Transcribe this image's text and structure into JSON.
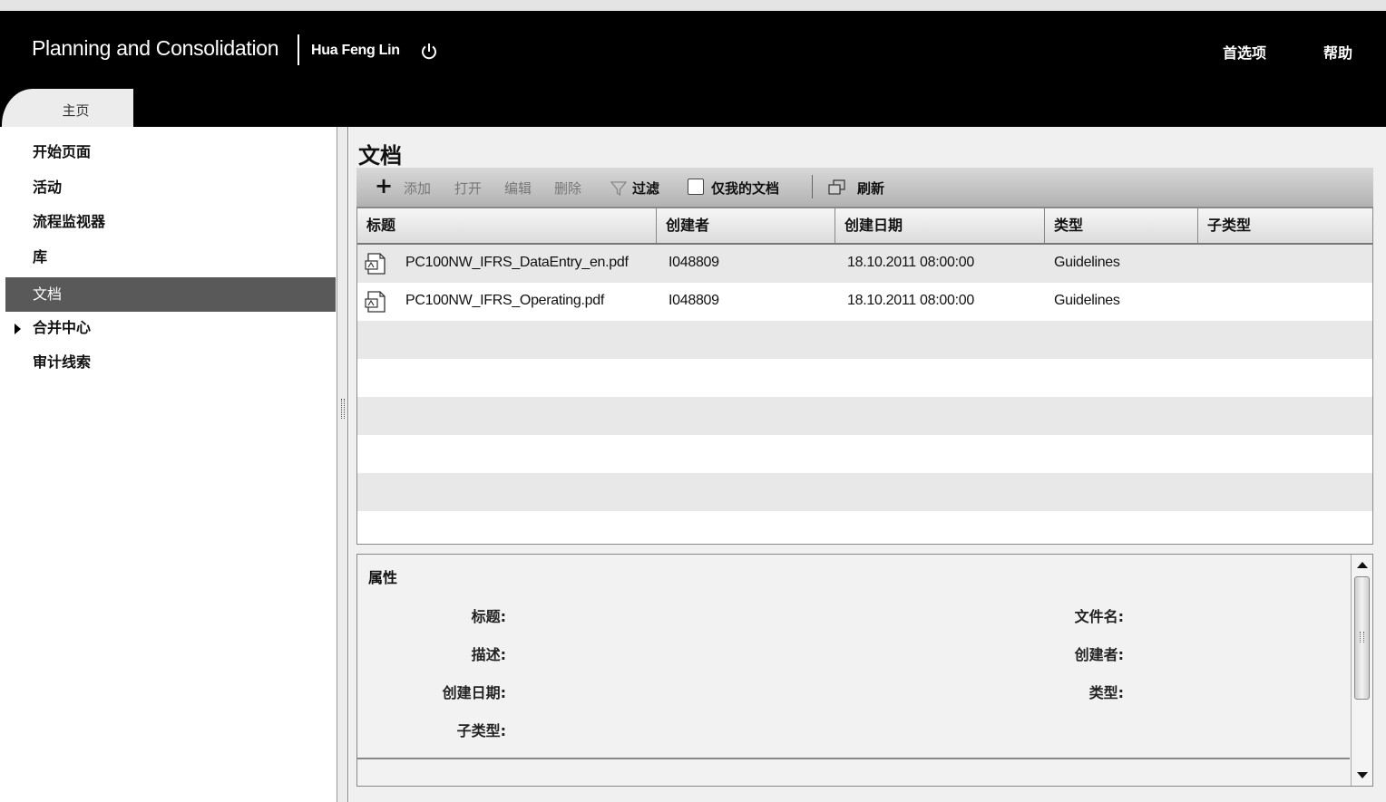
{
  "header": {
    "app_title": "Planning and Consolidation",
    "user_name": "Hua Feng Lin",
    "preferences": "首选项",
    "help": "帮助"
  },
  "tabs": {
    "home": "主页"
  },
  "sidebar": {
    "items": [
      {
        "label": "开始页面",
        "active": false
      },
      {
        "label": "活动",
        "active": false
      },
      {
        "label": "流程监视器",
        "active": false
      },
      {
        "label": "库",
        "active": false
      },
      {
        "label": "文档",
        "active": true
      },
      {
        "label": "合并中心",
        "active": false,
        "expandable": true
      },
      {
        "label": "审计线索",
        "active": false
      }
    ]
  },
  "main": {
    "title": "文档",
    "toolbar": {
      "add": "添加",
      "open": "打开",
      "edit": "编辑",
      "delete": "删除",
      "filter": "过滤",
      "my_docs_only": "仅我的文档",
      "refresh": "刷新"
    },
    "grid": {
      "columns": [
        "标题",
        "创建者",
        "创建日期",
        "类型",
        "子类型"
      ],
      "rows": [
        {
          "title": "PC100NW_IFRS_DataEntry_en.pdf",
          "creator": "I048809",
          "date": "18.10.2011 08:00:00",
          "type": "Guidelines",
          "subtype": ""
        },
        {
          "title": "PC100NW_IFRS_Operating.pdf",
          "creator": "I048809",
          "date": "18.10.2011 08:00:00",
          "type": "Guidelines",
          "subtype": ""
        }
      ]
    },
    "properties": {
      "title": "属性",
      "left_labels": [
        "标题:",
        "描述:",
        "创建日期:",
        "子类型:"
      ],
      "right_labels": [
        "文件名:",
        "创建者:",
        "类型:"
      ]
    }
  },
  "colors": {
    "header_bg": "#000000",
    "active_nav": "#595959",
    "toolbar": "#b2b2b2",
    "row_alt": "#e8e8e8"
  },
  "icons": {
    "power": "power-icon",
    "add": "plus-icon",
    "filter": "filter-icon",
    "refresh": "refresh-icon",
    "document": "pdf-icon"
  }
}
